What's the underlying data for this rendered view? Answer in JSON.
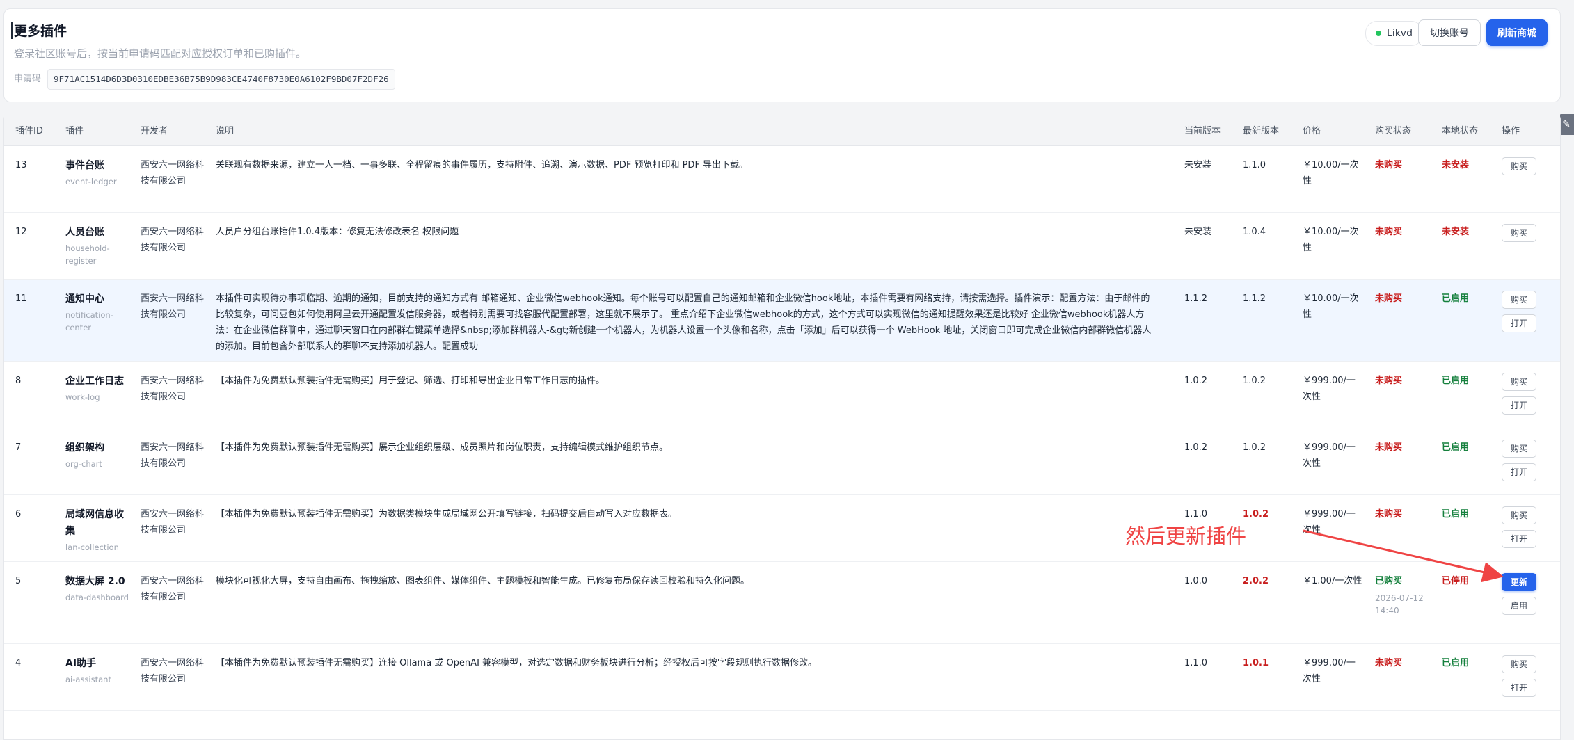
{
  "header": {
    "title": "更多插件",
    "subtitle": "登录社区账号后，按当前申请码匹配对应授权订单和已购插件。",
    "code_label": "申请码",
    "code_value": "9F71AC1514D6D3D0310EDBE36B75B9D983CE4740F8730E0A6102F9BD07F2DF26",
    "user_name": "Likvd",
    "switch_account": "切换账号",
    "refresh_store": "刷新商城"
  },
  "table": {
    "columns": [
      "插件ID",
      "插件",
      "开发者",
      "说明",
      "当前版本",
      "最新版本",
      "价格",
      "购买状态",
      "本地状态",
      "操作"
    ],
    "rows": [
      {
        "id": "13",
        "name": "事件台账",
        "slug": "event-ledger",
        "dev": "西安六一网络科技有限公司",
        "desc": "关联现有数据来源，建立一人一档、一事多联、全程留痕的事件履历，支持附件、追溯、演示数据、PDF 预览打印和 PDF 导出下载。",
        "current": "未安装",
        "latest": "1.1.0",
        "price": "￥10.00/一次性",
        "buy": "未购买",
        "local": "未安装",
        "actions": [
          "购买"
        ]
      },
      {
        "id": "12",
        "name": "人员台账",
        "slug": "household-register",
        "dev": "西安六一网络科技有限公司",
        "desc": "人员户分组台账插件1.0.4版本：修复无法修改表名 权限问题",
        "current": "未安装",
        "latest": "1.0.4",
        "price": "￥10.00/一次性",
        "buy": "未购买",
        "local": "未安装",
        "actions": [
          "购买"
        ]
      },
      {
        "id": "11",
        "name": "通知中心",
        "slug": "notification-center",
        "dev": "西安六一网络科技有限公司",
        "desc": "本插件可实现待办事项临期、逾期的通知，目前支持的通知方式有 邮箱通知、企业微信webhook通知。每个账号可以配置自己的通知邮箱和企业微信hook地址，本插件需要有网络支持，请按需选择。插件演示：配置方法：由于邮件的比较复杂，可问豆包如何使用阿里云开通配置发信服务器，或者特别需要可找客服代配置部署，这里就不展示了。 重点介绍下企业微信webhook的方式，这个方式可以实现微信的通知提醒效果还是比较好 企业微信webhook机器人方法：在企业微信群聊中，通过聊天窗口在内部群右键菜单选择&nbsp;添加群机器人-&gt;新创建一个机器人，为机器人设置一个头像和名称，点击「添加」后可以获得一个 WebHook 地址，关闭窗口即可完成企业微信内部群微信机器人的添加。目前包含外部联系人的群聊不支持添加机器人。配置成功",
        "current": "1.1.2",
        "latest": "1.1.2",
        "price": "￥10.00/一次性",
        "buy": "未购买",
        "local": "已启用",
        "actions": [
          "购买",
          "打开"
        ]
      },
      {
        "id": "8",
        "name": "企业工作日志",
        "slug": "work-log",
        "dev": "西安六一网络科技有限公司",
        "desc": "【本插件为免费默认预装插件无需购买】用于登记、筛选、打印和导出企业日常工作日志的插件。",
        "current": "1.0.2",
        "latest": "1.0.2",
        "price": "￥999.00/一次性",
        "buy": "未购买",
        "local": "已启用",
        "actions": [
          "购买",
          "打开"
        ]
      },
      {
        "id": "7",
        "name": "组织架构",
        "slug": "org-chart",
        "dev": "西安六一网络科技有限公司",
        "desc": "【本插件为免费默认预装插件无需购买】展示企业组织层级、成员照片和岗位职责，支持编辑模式维护组织节点。",
        "current": "1.0.2",
        "latest": "1.0.2",
        "price": "￥999.00/一次性",
        "buy": "未购买",
        "local": "已启用",
        "actions": [
          "购买",
          "打开"
        ]
      },
      {
        "id": "6",
        "name": "局域网信息收集",
        "slug": "lan-collection",
        "dev": "西安六一网络科技有限公司",
        "desc": "【本插件为免费默认预装插件无需购买】为数据类模块生成局域网公开填写链接，扫码提交后自动写入对应数据表。",
        "current": "1.1.0",
        "latest": "1.0.2",
        "price": "￥999.00/一次性",
        "buy": "未购买",
        "local": "已启用",
        "actions": [
          "购买",
          "打开"
        ]
      },
      {
        "id": "5",
        "name": "数据大屏 2.0",
        "slug": "data-dashboard",
        "dev": "西安六一网络科技有限公司",
        "desc": "模块化可视化大屏，支持自由画布、拖拽缩放、图表组件、媒体组件、主题模板和智能生成。已修复布局保存读回校验和持久化问题。",
        "current": "1.0.0",
        "latest": "2.0.2",
        "price": "￥1.00/一次性",
        "buy": "已购买",
        "buy_date": "2026-07-12 14:40",
        "local": "已停用",
        "actions": [
          "更新",
          "启用"
        ]
      },
      {
        "id": "4",
        "name": "AI助手",
        "slug": "ai-assistant",
        "dev": "西安六一网络科技有限公司",
        "desc": "【本插件为免费默认预装插件无需购买】连接 Ollama 或 OpenAI 兼容模型，对选定数据和财务板块进行分析；经授权后可按字段规则执行数据修改。",
        "current": "1.1.0",
        "latest": "1.0.1",
        "price": "￥999.00/一次性",
        "buy": "未购买",
        "local": "已启用",
        "actions": [
          "购买",
          "打开"
        ]
      }
    ]
  },
  "annotation": {
    "text": "然后更新插件",
    "color": "#ef4444"
  },
  "colors": {
    "primary": "#2563eb",
    "red_status": "#c81e1e",
    "green_status": "#15803d",
    "online_dot": "#22c55e"
  },
  "icons": {
    "side_tab": "magic-wand-icon",
    "user_status": "online-dot-icon"
  }
}
